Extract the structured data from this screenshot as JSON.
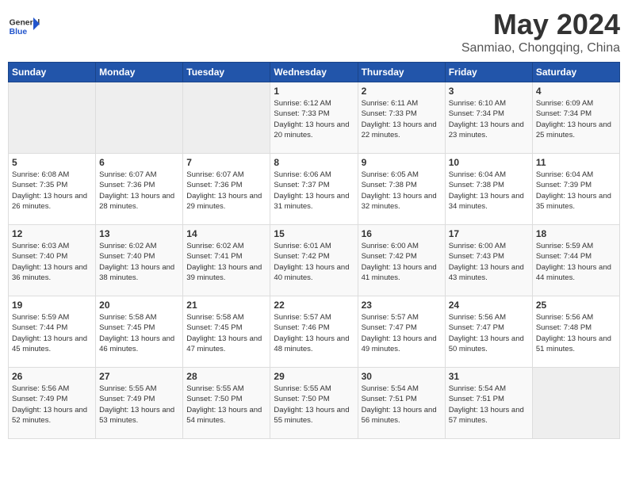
{
  "header": {
    "logo_general": "General",
    "logo_blue": "Blue",
    "title": "May 2024",
    "subtitle": "Sanmiao, Chongqing, China"
  },
  "weekdays": [
    "Sunday",
    "Monday",
    "Tuesday",
    "Wednesday",
    "Thursday",
    "Friday",
    "Saturday"
  ],
  "weeks": [
    [
      {
        "day": "",
        "empty": true
      },
      {
        "day": "",
        "empty": true
      },
      {
        "day": "",
        "empty": true
      },
      {
        "day": "1",
        "sunrise": "6:12 AM",
        "sunset": "7:33 PM",
        "daylight": "13 hours and 20 minutes."
      },
      {
        "day": "2",
        "sunrise": "6:11 AM",
        "sunset": "7:33 PM",
        "daylight": "13 hours and 22 minutes."
      },
      {
        "day": "3",
        "sunrise": "6:10 AM",
        "sunset": "7:34 PM",
        "daylight": "13 hours and 23 minutes."
      },
      {
        "day": "4",
        "sunrise": "6:09 AM",
        "sunset": "7:34 PM",
        "daylight": "13 hours and 25 minutes."
      }
    ],
    [
      {
        "day": "5",
        "sunrise": "6:08 AM",
        "sunset": "7:35 PM",
        "daylight": "13 hours and 26 minutes."
      },
      {
        "day": "6",
        "sunrise": "6:07 AM",
        "sunset": "7:36 PM",
        "daylight": "13 hours and 28 minutes."
      },
      {
        "day": "7",
        "sunrise": "6:07 AM",
        "sunset": "7:36 PM",
        "daylight": "13 hours and 29 minutes."
      },
      {
        "day": "8",
        "sunrise": "6:06 AM",
        "sunset": "7:37 PM",
        "daylight": "13 hours and 31 minutes."
      },
      {
        "day": "9",
        "sunrise": "6:05 AM",
        "sunset": "7:38 PM",
        "daylight": "13 hours and 32 minutes."
      },
      {
        "day": "10",
        "sunrise": "6:04 AM",
        "sunset": "7:38 PM",
        "daylight": "13 hours and 34 minutes."
      },
      {
        "day": "11",
        "sunrise": "6:04 AM",
        "sunset": "7:39 PM",
        "daylight": "13 hours and 35 minutes."
      }
    ],
    [
      {
        "day": "12",
        "sunrise": "6:03 AM",
        "sunset": "7:40 PM",
        "daylight": "13 hours and 36 minutes."
      },
      {
        "day": "13",
        "sunrise": "6:02 AM",
        "sunset": "7:40 PM",
        "daylight": "13 hours and 38 minutes."
      },
      {
        "day": "14",
        "sunrise": "6:02 AM",
        "sunset": "7:41 PM",
        "daylight": "13 hours and 39 minutes."
      },
      {
        "day": "15",
        "sunrise": "6:01 AM",
        "sunset": "7:42 PM",
        "daylight": "13 hours and 40 minutes."
      },
      {
        "day": "16",
        "sunrise": "6:00 AM",
        "sunset": "7:42 PM",
        "daylight": "13 hours and 41 minutes."
      },
      {
        "day": "17",
        "sunrise": "6:00 AM",
        "sunset": "7:43 PM",
        "daylight": "13 hours and 43 minutes."
      },
      {
        "day": "18",
        "sunrise": "5:59 AM",
        "sunset": "7:44 PM",
        "daylight": "13 hours and 44 minutes."
      }
    ],
    [
      {
        "day": "19",
        "sunrise": "5:59 AM",
        "sunset": "7:44 PM",
        "daylight": "13 hours and 45 minutes."
      },
      {
        "day": "20",
        "sunrise": "5:58 AM",
        "sunset": "7:45 PM",
        "daylight": "13 hours and 46 minutes."
      },
      {
        "day": "21",
        "sunrise": "5:58 AM",
        "sunset": "7:45 PM",
        "daylight": "13 hours and 47 minutes."
      },
      {
        "day": "22",
        "sunrise": "5:57 AM",
        "sunset": "7:46 PM",
        "daylight": "13 hours and 48 minutes."
      },
      {
        "day": "23",
        "sunrise": "5:57 AM",
        "sunset": "7:47 PM",
        "daylight": "13 hours and 49 minutes."
      },
      {
        "day": "24",
        "sunrise": "5:56 AM",
        "sunset": "7:47 PM",
        "daylight": "13 hours and 50 minutes."
      },
      {
        "day": "25",
        "sunrise": "5:56 AM",
        "sunset": "7:48 PM",
        "daylight": "13 hours and 51 minutes."
      }
    ],
    [
      {
        "day": "26",
        "sunrise": "5:56 AM",
        "sunset": "7:49 PM",
        "daylight": "13 hours and 52 minutes."
      },
      {
        "day": "27",
        "sunrise": "5:55 AM",
        "sunset": "7:49 PM",
        "daylight": "13 hours and 53 minutes."
      },
      {
        "day": "28",
        "sunrise": "5:55 AM",
        "sunset": "7:50 PM",
        "daylight": "13 hours and 54 minutes."
      },
      {
        "day": "29",
        "sunrise": "5:55 AM",
        "sunset": "7:50 PM",
        "daylight": "13 hours and 55 minutes."
      },
      {
        "day": "30",
        "sunrise": "5:54 AM",
        "sunset": "7:51 PM",
        "daylight": "13 hours and 56 minutes."
      },
      {
        "day": "31",
        "sunrise": "5:54 AM",
        "sunset": "7:51 PM",
        "daylight": "13 hours and 57 minutes."
      },
      {
        "day": "",
        "empty": true
      }
    ]
  ]
}
